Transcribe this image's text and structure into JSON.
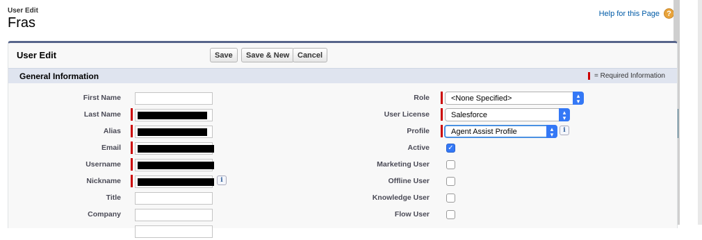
{
  "page": {
    "type_label": "User Edit",
    "title": "Fras"
  },
  "help": {
    "link_text": "Help for this Page",
    "icon_glyph": "?"
  },
  "block": {
    "title": "User Edit",
    "buttons": {
      "save": "Save",
      "save_new": "Save & New",
      "cancel": "Cancel"
    }
  },
  "section": {
    "title": "General Information",
    "required_legend": "= Required Information"
  },
  "left_fields": [
    {
      "label": "First Name",
      "value": "",
      "required": false
    },
    {
      "label": "Last Name",
      "value": "",
      "required": true,
      "redacted": true
    },
    {
      "label": "Alias",
      "value": "",
      "required": true,
      "redacted": true
    },
    {
      "label": "Email",
      "value": "",
      "required": true,
      "redacted": true
    },
    {
      "label": "Username",
      "value": "",
      "required": true,
      "redacted": true
    },
    {
      "label": "Nickname",
      "value": "",
      "required": true,
      "redacted": true,
      "info": true
    },
    {
      "label": "Title",
      "value": "",
      "required": false
    },
    {
      "label": "Company",
      "value": "",
      "required": false
    }
  ],
  "right_fields": {
    "role": {
      "label": "Role",
      "value": "<None Specified>"
    },
    "user_license": {
      "label": "User License",
      "value": "Salesforce"
    },
    "profile": {
      "label": "Profile",
      "value": "Agent Assist Profile"
    },
    "active": {
      "label": "Active",
      "checked": true
    },
    "marketing_user": {
      "label": "Marketing User",
      "checked": false
    },
    "offline_user": {
      "label": "Offline User",
      "checked": false
    },
    "knowledge_user": {
      "label": "Knowledge User",
      "checked": false
    },
    "flow_user": {
      "label": "Flow User",
      "checked": false
    }
  },
  "colors": {
    "header_border": "#56648a",
    "section_bg": "#dfe4ef",
    "required": "#cc0000",
    "select_accent": "#3478f6",
    "help_link": "#015ba7"
  }
}
